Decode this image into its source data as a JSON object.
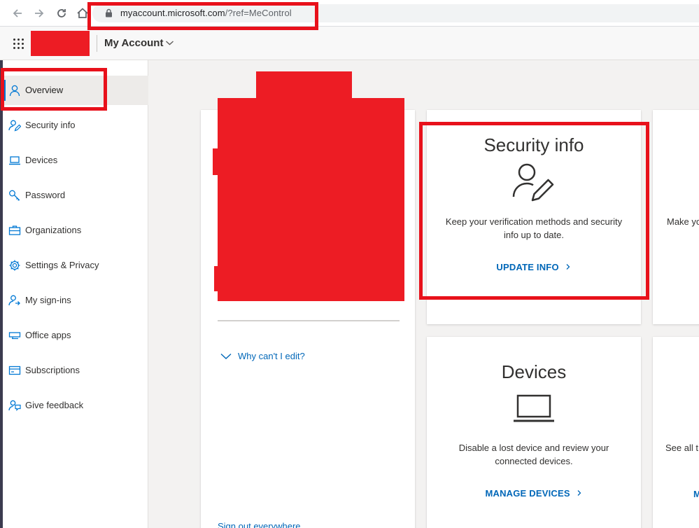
{
  "browser": {
    "url_main": "myaccount.microsoft.com",
    "url_rest": "/?ref=MeControl"
  },
  "header": {
    "app_title": "My Account"
  },
  "sidebar": {
    "items": [
      {
        "label": "Overview",
        "icon": "person-icon"
      },
      {
        "label": "Security info",
        "icon": "person-edit-icon"
      },
      {
        "label": "Devices",
        "icon": "laptop-icon"
      },
      {
        "label": "Password",
        "icon": "key-icon"
      },
      {
        "label": "Organizations",
        "icon": "briefcase-icon"
      },
      {
        "label": "Settings & Privacy",
        "icon": "gear-icon"
      },
      {
        "label": "My sign-ins",
        "icon": "person-sign-in-icon"
      },
      {
        "label": "Office apps",
        "icon": "office-apps-icon"
      },
      {
        "label": "Subscriptions",
        "icon": "subscriptions-icon"
      },
      {
        "label": "Give feedback",
        "icon": "feedback-icon"
      }
    ]
  },
  "profile_card": {
    "why_link": "Why can't I edit?",
    "signout_link": "Sign out everywhere"
  },
  "security_card": {
    "title": "Security info",
    "description": "Keep your verification methods and security info up to date.",
    "link": "UPDATE INFO"
  },
  "devices_card": {
    "title": "Devices",
    "description": "Disable a lost device and review your connected devices.",
    "link": "MANAGE DEVICES"
  },
  "partial_cards": {
    "top_desc": "Make yo",
    "bottom_desc": "See all t",
    "bottom_link": "M"
  },
  "colors": {
    "accent": "#0078d4",
    "link": "#0067b8",
    "redaction": "#ed1c24",
    "highlight": "#e8111b"
  }
}
